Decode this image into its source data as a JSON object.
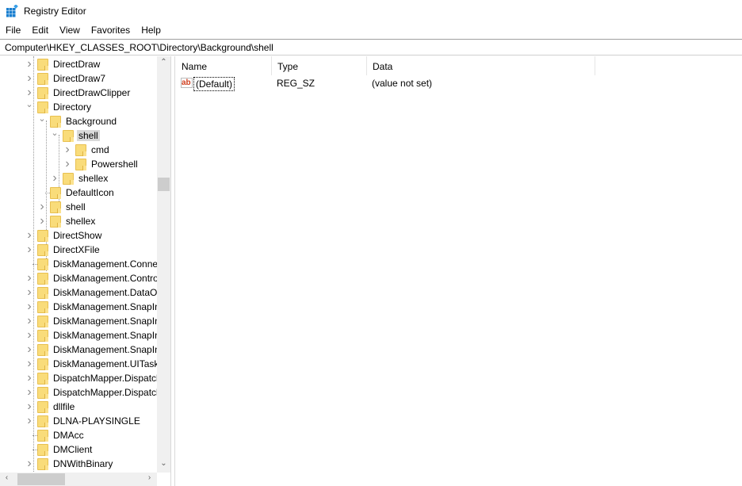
{
  "window": {
    "title": "Registry Editor",
    "icon": "registry-icon"
  },
  "menu": [
    "File",
    "Edit",
    "View",
    "Favorites",
    "Help"
  ],
  "address": "Computer\\HKEY_CLASSES_ROOT\\Directory\\Background\\shell",
  "tree": [
    {
      "label": "DirectDraw",
      "level": 1,
      "expander": "collapsed"
    },
    {
      "label": "DirectDraw7",
      "level": 1,
      "expander": "collapsed"
    },
    {
      "label": "DirectDrawClipper",
      "level": 1,
      "expander": "collapsed"
    },
    {
      "label": "Directory",
      "level": 1,
      "expander": "expanded"
    },
    {
      "label": "Background",
      "level": 2,
      "expander": "expanded"
    },
    {
      "label": "shell",
      "level": 3,
      "expander": "expanded",
      "selected": true
    },
    {
      "label": "cmd",
      "level": 4,
      "expander": "collapsed"
    },
    {
      "label": "Powershell",
      "level": 4,
      "expander": "collapsed"
    },
    {
      "label": "shellex",
      "level": 3,
      "expander": "collapsed"
    },
    {
      "label": "DefaultIcon",
      "level": 2,
      "expander": "none"
    },
    {
      "label": "shell",
      "level": 2,
      "expander": "collapsed"
    },
    {
      "label": "shellex",
      "level": 2,
      "expander": "collapsed"
    },
    {
      "label": "DirectShow",
      "level": 1,
      "expander": "collapsed"
    },
    {
      "label": "DirectXFile",
      "level": 1,
      "expander": "collapsed"
    },
    {
      "label": "DiskManagement.Conne",
      "level": 1,
      "expander": "none"
    },
    {
      "label": "DiskManagement.Contro",
      "level": 1,
      "expander": "collapsed"
    },
    {
      "label": "DiskManagement.DataOl",
      "level": 1,
      "expander": "collapsed"
    },
    {
      "label": "DiskManagement.SnapIn",
      "level": 1,
      "expander": "collapsed"
    },
    {
      "label": "DiskManagement.SnapIn",
      "level": 1,
      "expander": "collapsed"
    },
    {
      "label": "DiskManagement.SnapIn",
      "level": 1,
      "expander": "collapsed"
    },
    {
      "label": "DiskManagement.SnapIn",
      "level": 1,
      "expander": "collapsed"
    },
    {
      "label": "DiskManagement.UITasks",
      "level": 1,
      "expander": "collapsed"
    },
    {
      "label": "DispatchMapper.Dispatcl",
      "level": 1,
      "expander": "collapsed"
    },
    {
      "label": "DispatchMapper.Dispatcl",
      "level": 1,
      "expander": "collapsed"
    },
    {
      "label": "dllfile",
      "level": 1,
      "expander": "collapsed"
    },
    {
      "label": "DLNA-PLAYSINGLE",
      "level": 1,
      "expander": "collapsed"
    },
    {
      "label": "DMAcc",
      "level": 1,
      "expander": "none"
    },
    {
      "label": "DMClient",
      "level": 1,
      "expander": "none"
    },
    {
      "label": "DNWithBinary",
      "level": 1,
      "expander": "collapsed"
    }
  ],
  "list": {
    "columns": [
      "Name",
      "Type",
      "Data"
    ],
    "rows": [
      {
        "icon": "ab",
        "name": "(Default)",
        "type": "REG_SZ",
        "data": "(value not set)"
      }
    ]
  }
}
